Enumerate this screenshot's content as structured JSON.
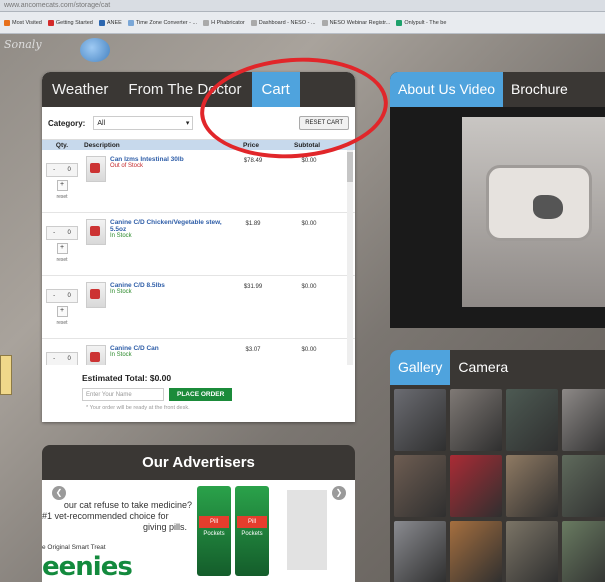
{
  "browser": {
    "url": "www.ancomecats.com/storage/cat",
    "bookmarks": [
      {
        "label": "Most Visited",
        "color": "#e7701c"
      },
      {
        "label": "Getting Started",
        "color": "#d32b2b"
      },
      {
        "label": "ANEE",
        "color": "#2c67b0"
      },
      {
        "label": "Time Zone Converter - ...",
        "color": "#7aa7d7"
      },
      {
        "label": "H Phabricator",
        "color": "#aaa"
      },
      {
        "label": "Dashboard - NESO - ...",
        "color": "#aaa"
      },
      {
        "label": "NESO Webinar Registr...",
        "color": "#aaa"
      },
      {
        "label": "Onlypult - The be",
        "color": "#1ea16c"
      }
    ]
  },
  "site": {
    "logo_text": "Sonaly"
  },
  "left_panel": {
    "tabs": [
      "Weather",
      "From The Doctor",
      "Cart"
    ],
    "active_tab": "Cart",
    "category_label": "Category:",
    "category_value": "All",
    "reset_label": "RESET CART",
    "columns": [
      "Qty.",
      "Description",
      "Price",
      "Subtotal"
    ],
    "items": [
      {
        "qty": "0",
        "name": "Can Izms Intestinal 30lb",
        "status": "Out of Stock",
        "in_stock": false,
        "price": "$78.49",
        "subtotal": "$0.00"
      },
      {
        "qty": "0",
        "name": "Canine C/D Chicken/Vegetable stew, 5.5oz",
        "status": "In Stock",
        "in_stock": true,
        "price": "$1.89",
        "subtotal": "$0.00"
      },
      {
        "qty": "0",
        "name": "Canine C/D 8.5lbs",
        "status": "In Stock",
        "in_stock": true,
        "price": "$31.99",
        "subtotal": "$0.00"
      },
      {
        "qty": "0",
        "name": "Canine C/D Can",
        "status": "In Stock",
        "in_stock": true,
        "price": "$3.07",
        "subtotal": "$0.00"
      }
    ],
    "reset_small": "reset",
    "estimated_total": "Estimated Total: $0.00",
    "name_placeholder": "Enter Your Name",
    "place_order": "PLACE ORDER",
    "note": "* Your order will be ready at the front desk."
  },
  "advertisers": {
    "title": "Our Advertisers",
    "line1": "our cat refuse to take medicine?",
    "line2": "#1 vet-recommended choice for",
    "line3": "giving pills.",
    "line4": "e Original Smart Treat",
    "brand": "eenies",
    "pkg_labels": [
      "Pill Pockets",
      "Pill Pockets"
    ]
  },
  "video_panel": {
    "tabs": [
      "About Us Video",
      "Brochure"
    ],
    "active_tab": "About Us Video"
  },
  "gallery_panel": {
    "tabs": [
      "Gallery",
      "Camera"
    ],
    "active_tab": "Gallery",
    "thumb_colors": [
      "#6b6c72",
      "#7f7975",
      "#4d5a53",
      "#8d8987",
      "#6e5d52",
      "#aa2b35",
      "#8f7a63",
      "#5f6a5c",
      "#8a8b90",
      "#a56f3f",
      "#7b7466",
      "#697b61"
    ]
  },
  "colors": {
    "accent": "#4fa3dd",
    "panel_dark": "#3a3734",
    "stock_green": "#2b8a2b",
    "out_red": "#c3272b",
    "annotation_red": "#e1262a"
  }
}
